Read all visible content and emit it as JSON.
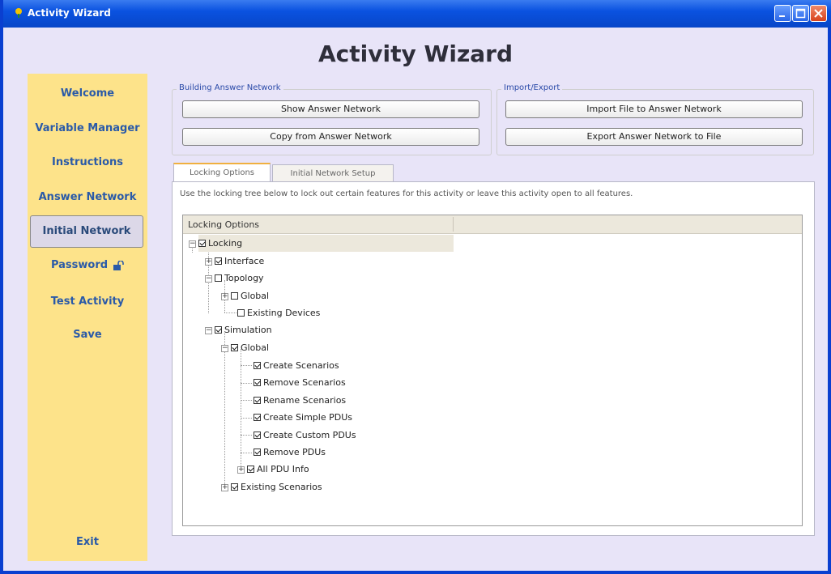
{
  "window": {
    "title": "Activity Wizard"
  },
  "app": {
    "title": "Activity Wizard"
  },
  "sidebar": {
    "items": [
      {
        "label": "Welcome",
        "active": false
      },
      {
        "label": "Variable Manager",
        "active": false
      },
      {
        "label": "Instructions",
        "active": false
      },
      {
        "label": "Answer Network",
        "active": false
      },
      {
        "label": "Initial Network",
        "active": true
      },
      {
        "label": "Password",
        "active": false,
        "icon": "unlock-icon"
      },
      {
        "label": "Test Activity",
        "active": false
      },
      {
        "label": "Save",
        "active": false
      }
    ],
    "exit_label": "Exit"
  },
  "building": {
    "legend": "Building Answer Network",
    "show_label": "Show Answer Network",
    "copy_label": "Copy from Answer Network"
  },
  "importexport": {
    "legend": "Import/Export",
    "import_label": "Import File to Answer Network",
    "export_label": "Export Answer Network to File"
  },
  "tabs": {
    "items": [
      {
        "label": "Locking Options",
        "active": true
      },
      {
        "label": "Initial Network Setup",
        "active": false
      }
    ]
  },
  "instructions_text": "Use the locking tree below to lock out certain features for this activity or leave this activity open to all features.",
  "tree": {
    "header": "Locking Options",
    "nodes": [
      {
        "label": "Locking",
        "checked": true
      },
      {
        "label": "Interface",
        "checked": true
      },
      {
        "label": "Topology",
        "checked": false
      },
      {
        "label": "Global",
        "checked": false
      },
      {
        "label": "Existing Devices",
        "checked": false
      },
      {
        "label": "Simulation",
        "checked": true
      },
      {
        "label": "Global",
        "checked": true
      },
      {
        "label": "Create Scenarios",
        "checked": true
      },
      {
        "label": "Remove Scenarios",
        "checked": true
      },
      {
        "label": "Rename Scenarios",
        "checked": true
      },
      {
        "label": "Create Simple PDUs",
        "checked": true
      },
      {
        "label": "Create Custom PDUs",
        "checked": true
      },
      {
        "label": "Remove PDUs",
        "checked": true
      },
      {
        "label": "All PDU Info",
        "checked": true
      },
      {
        "label": "Existing Scenarios",
        "checked": true
      }
    ]
  },
  "colors": {
    "titlebar": "#0a52e0",
    "sidebar": "#fde38a",
    "nav_text": "#2a5aa8",
    "window_bg": "#e8e4f8"
  }
}
